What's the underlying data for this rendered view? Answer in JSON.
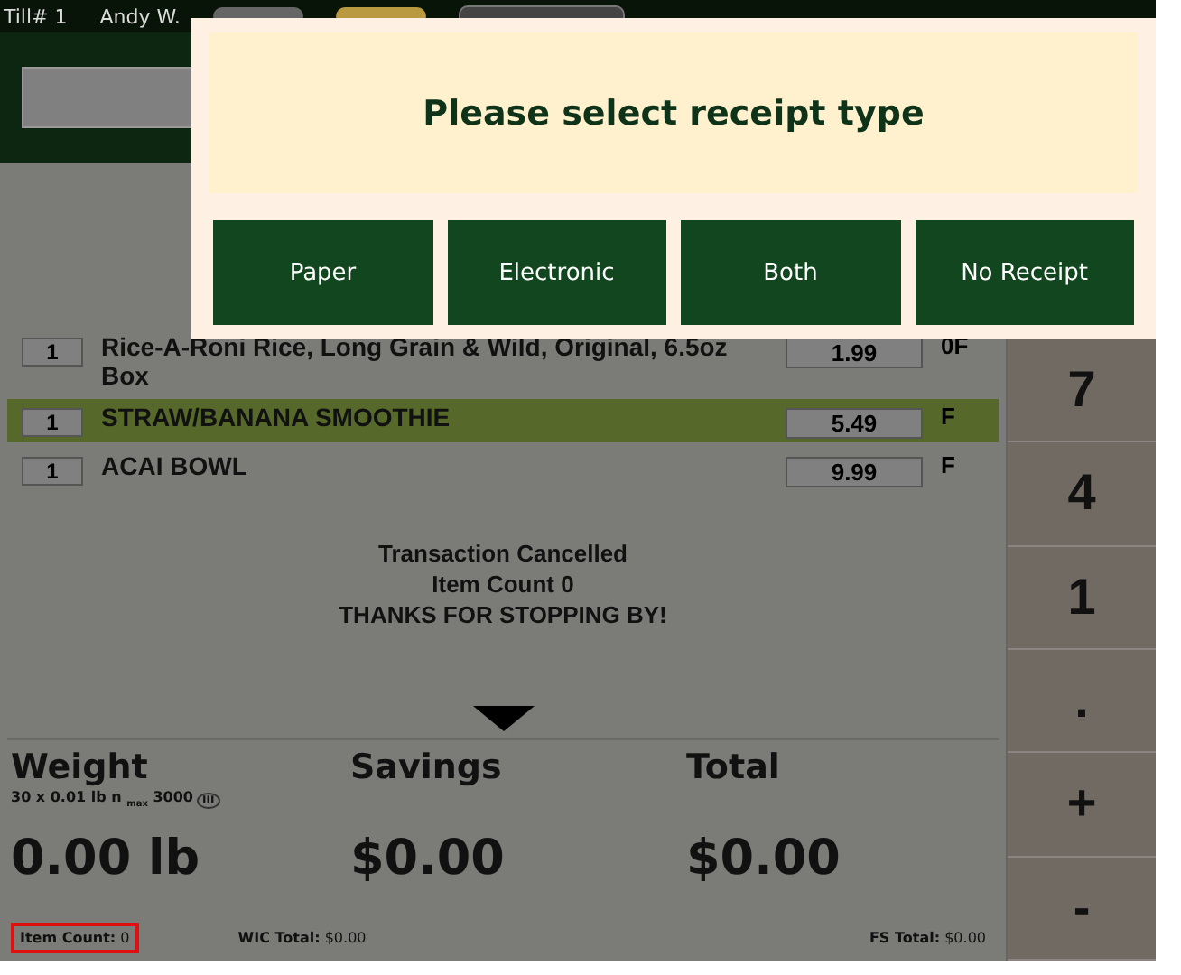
{
  "top_bar": {
    "till": "Till# 1",
    "user": "Andy W."
  },
  "items": [
    {
      "qty": "1",
      "description": "Rice-A-Roni Rice, Long Grain & Wild, Original, 6.5oz Box",
      "price": "1.99",
      "tax": "0F",
      "selected": false
    },
    {
      "qty": "1",
      "description": "STRAW/BANANA SMOOTHIE",
      "price": "5.49",
      "tax": "F",
      "selected": true
    },
    {
      "qty": "1",
      "description": "ACAI BOWL",
      "price": "9.99",
      "tax": "F",
      "selected": false
    }
  ],
  "messages": [
    "Transaction Cancelled",
    "Item Count 0",
    "THANKS FOR STOPPING BY!"
  ],
  "totals": {
    "weight_label": "Weight",
    "scale_spec": "30 x 0.01 lb n $_{max}$ 3000",
    "scale_class": "III",
    "weight": "0.00 lb",
    "savings_label": "Savings",
    "savings": "$0.00",
    "total_label": "Total",
    "total": "$0.00"
  },
  "footer": {
    "item_count": "**Item Count:** 0",
    "item_count_highlighted": true,
    "wic_total": "**WIC Total:** $0.00",
    "fs_total": "**FS Total:** $0.00"
  },
  "keypad": [
    "7",
    "4",
    "1",
    ".",
    "+",
    "-"
  ],
  "dialog": {
    "title": "Please select receipt type",
    "buttons": [
      "Paper",
      "Electronic",
      "Both",
      "No Receipt"
    ]
  }
}
